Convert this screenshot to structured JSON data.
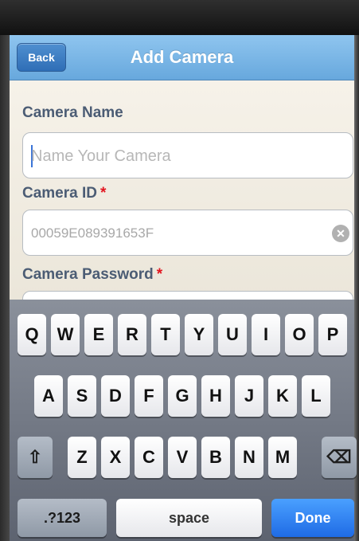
{
  "nav": {
    "back_label": "Back",
    "title": "Add Camera"
  },
  "form": {
    "camera_name_label": "Camera Name",
    "camera_name_placeholder": "Name Your Camera",
    "camera_id_label": "Camera ID",
    "camera_id_value": "00059E089391653F",
    "camera_password_label": "Camera Password",
    "required_marker": "*"
  },
  "keyboard": {
    "row1": [
      "Q",
      "W",
      "E",
      "R",
      "T",
      "Y",
      "U",
      "I",
      "O",
      "P"
    ],
    "row2": [
      "A",
      "S",
      "D",
      "F",
      "G",
      "H",
      "J",
      "K",
      "L"
    ],
    "row3": [
      "Z",
      "X",
      "C",
      "V",
      "B",
      "N",
      "M"
    ],
    "shift_glyph": "⇧",
    "backspace_glyph": "⌫",
    "mode_label": ".?123",
    "space_label": "space",
    "done_label": "Done"
  },
  "colors": {
    "nav_blue": "#6fb0e4",
    "required_red": "#e2151f",
    "done_blue": "#2a79f0"
  }
}
